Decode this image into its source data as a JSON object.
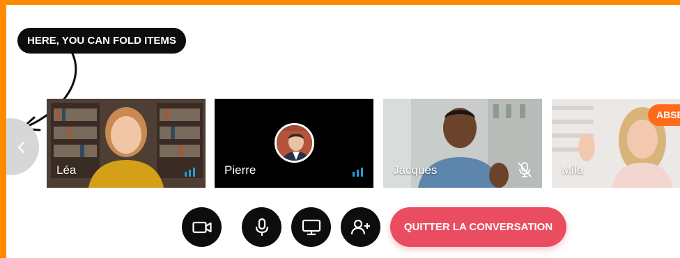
{
  "tooltip": {
    "text": "HERE, YOU CAN FOLD ITEMS"
  },
  "colors": {
    "frame": "#ff8a00",
    "quit": "#e94d5f",
    "badge": "#ff6a1a",
    "indicator": "#1fa0d6"
  },
  "fold_button": {
    "icon": "chevron-left-icon"
  },
  "participants": [
    {
      "name": "Léa",
      "status": "speaking",
      "icon": "audio-level-icon"
    },
    {
      "name": "Pierre",
      "status": "speaking",
      "icon": "audio-level-icon"
    },
    {
      "name": "Jacques",
      "status": "muted",
      "icon": "mic-off-icon"
    },
    {
      "name": "Mila",
      "status": "absent",
      "badge": "ABSENT"
    }
  ],
  "controls": [
    {
      "name": "camera",
      "icon": "video-camera-icon"
    },
    {
      "name": "microphone",
      "icon": "microphone-icon"
    },
    {
      "name": "screen-share",
      "icon": "monitor-icon"
    },
    {
      "name": "add-participant",
      "icon": "add-user-icon"
    }
  ],
  "quit_button": {
    "label": "QUITTER LA CONVERSATION"
  }
}
